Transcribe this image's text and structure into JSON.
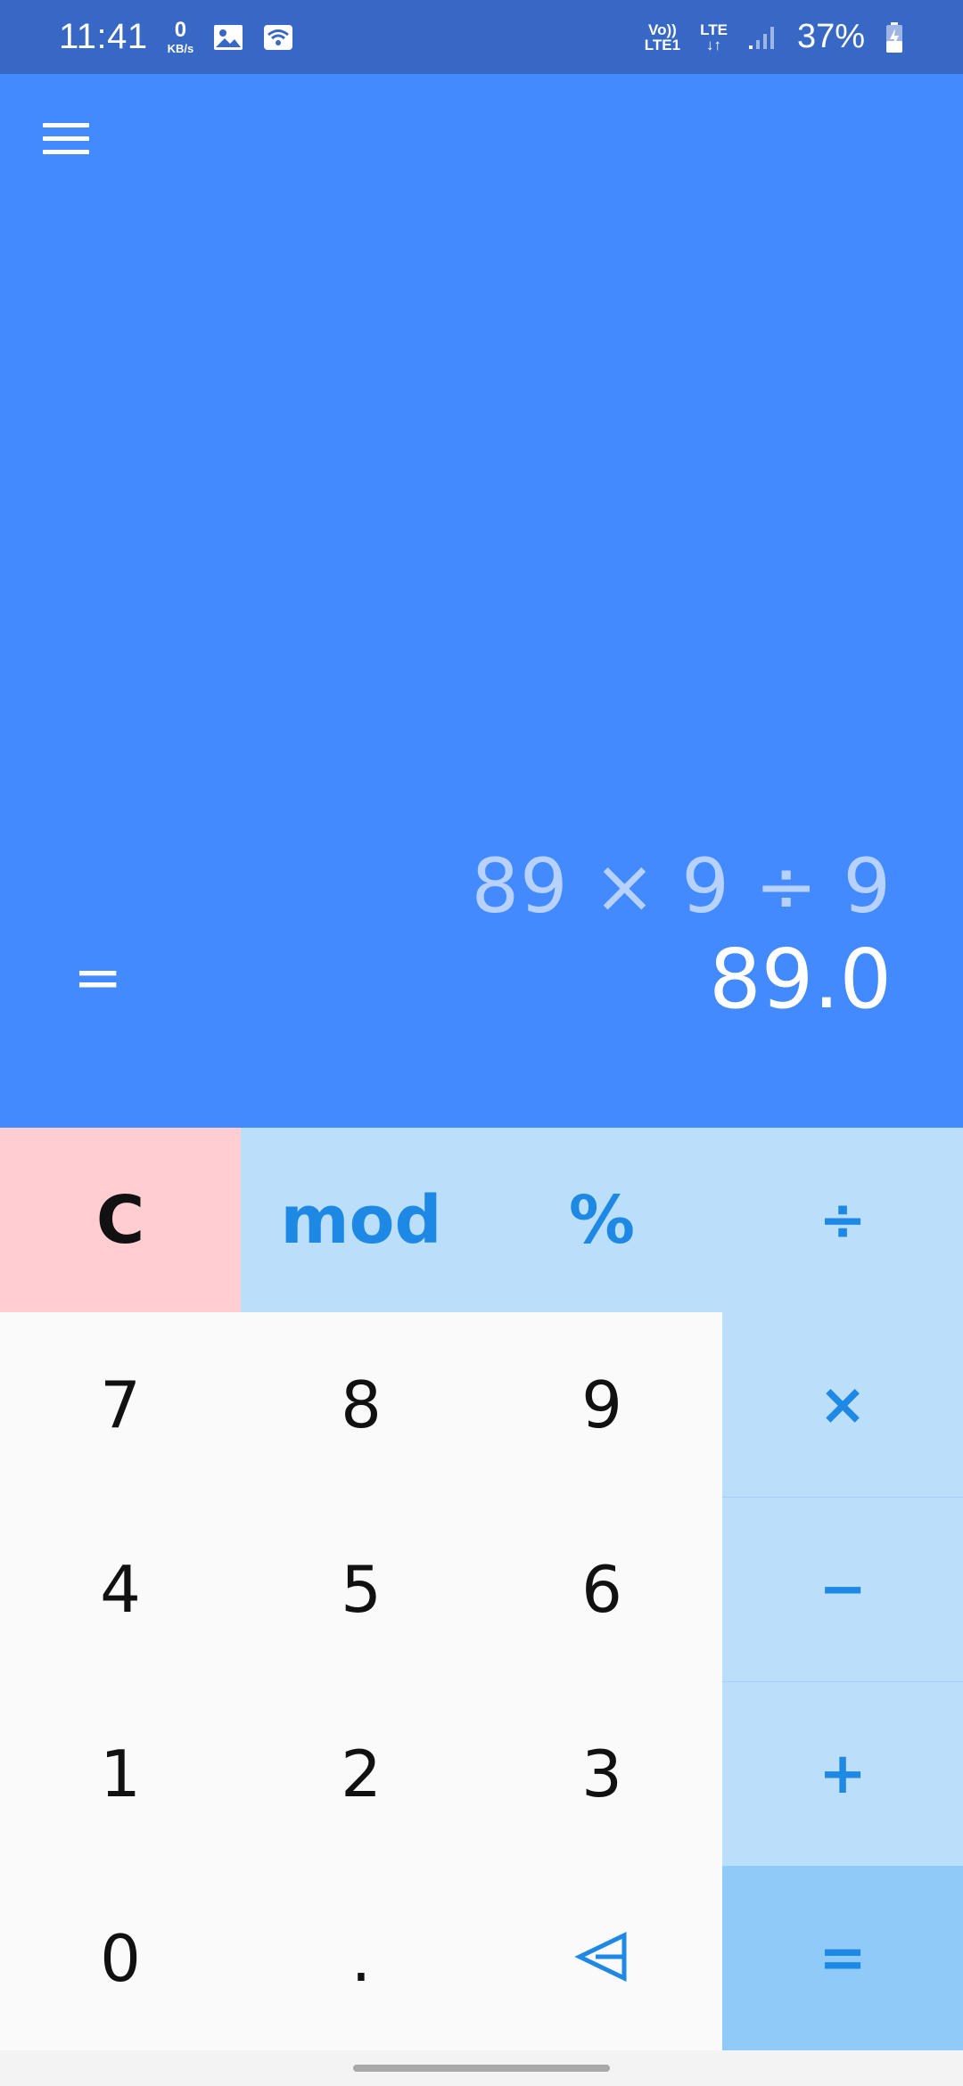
{
  "status_bar": {
    "time": "11:41",
    "net_speed_value": "0",
    "net_speed_unit": "KB/s",
    "volte_top": "Vo))",
    "volte_bottom": "LTE1",
    "lte_label": "LTE",
    "battery_percent": "37%",
    "icons": [
      "gallery-icon",
      "wifi-icon",
      "signal-icon",
      "battery-charging-icon"
    ]
  },
  "display": {
    "expression": "89 × 9 ÷ 9",
    "equals": "=",
    "result": "89.0"
  },
  "keypad": {
    "clear": "C",
    "mod": "mod",
    "percent": "%",
    "divide": "÷",
    "multiply": "×",
    "minus": "−",
    "plus": "+",
    "equals": "=",
    "digit_7": "7",
    "digit_8": "8",
    "digit_9": "9",
    "digit_4": "4",
    "digit_5": "5",
    "digit_6": "6",
    "digit_1": "1",
    "digit_2": "2",
    "digit_3": "3",
    "digit_0": "0",
    "decimal": "."
  },
  "colors": {
    "status_bar": "#3768c5",
    "display_bg": "#448aff",
    "clear_bg": "#ffcdd2",
    "operator_bg": "#bbdefb",
    "equals_bg": "#90caf9",
    "operator_text": "#1e88e5",
    "number_bg": "#fafafa"
  }
}
